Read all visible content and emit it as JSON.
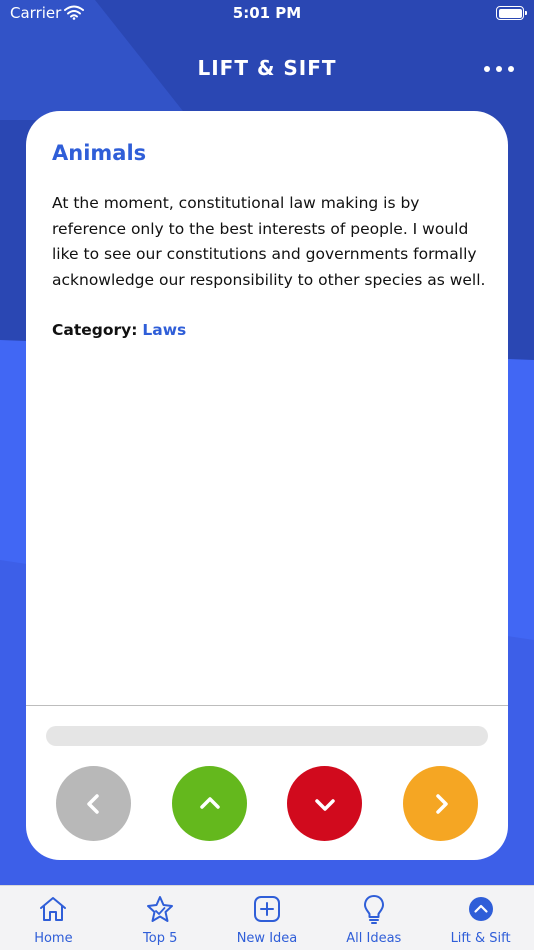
{
  "status_bar": {
    "carrier": "Carrier",
    "time": "5:01 PM"
  },
  "header": {
    "title": "LIFT & SIFT",
    "more_icon": "more-horizontal-icon"
  },
  "idea": {
    "title": "Animals",
    "body": "At the moment, constitutional law making is by reference only to the best interests of people. I would like to see our constitutions and governments formally acknowledge our responsibility to other species as well.",
    "category_label": "Category:",
    "category_value": "Laws",
    "progress_fraction": 0
  },
  "actions": [
    {
      "name": "previous",
      "icon": "chevron-left-icon",
      "color": "#b8b8b8"
    },
    {
      "name": "lift",
      "icon": "chevron-up-icon",
      "color": "#64b81d"
    },
    {
      "name": "sift",
      "icon": "chevron-down-icon",
      "color": "#d10a1d"
    },
    {
      "name": "next",
      "icon": "chevron-right-icon",
      "color": "#f5a623"
    }
  ],
  "tabs": [
    {
      "label": "Home",
      "icon": "home-icon"
    },
    {
      "label": "Top 5",
      "icon": "star-icon"
    },
    {
      "label": "New Idea",
      "icon": "plus-square-icon"
    },
    {
      "label": "All Ideas",
      "icon": "lightbulb-icon"
    },
    {
      "label": "Lift & Sift",
      "icon": "chevron-up-circle-icon",
      "selected": true
    }
  ],
  "colors": {
    "accent": "#2f5ed8",
    "background": "#2a47b3",
    "tab_bar": "#f3f3f5"
  }
}
